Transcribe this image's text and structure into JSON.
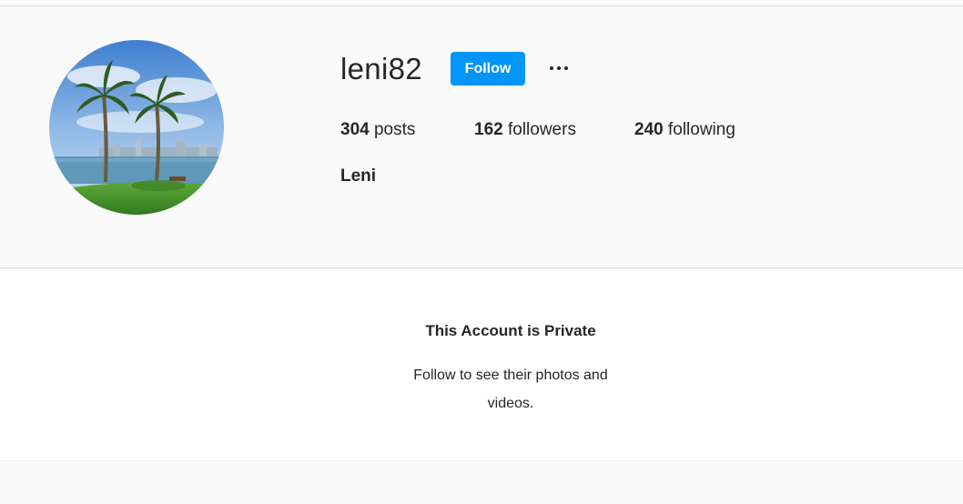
{
  "profile": {
    "username": "leni82",
    "full_name": "Leni",
    "avatar_icon": "palm-trees-beach-avatar"
  },
  "actions": {
    "follow_label": "Follow",
    "more_icon": "more-options-icon",
    "accent_color": "#0095f6"
  },
  "stats": {
    "posts": {
      "count": "304",
      "label": "posts"
    },
    "followers": {
      "count": "162",
      "label": "followers"
    },
    "following": {
      "count": "240",
      "label": "following"
    }
  },
  "private_notice": {
    "title": "This Account is Private",
    "message": "Follow to see their photos and videos."
  }
}
